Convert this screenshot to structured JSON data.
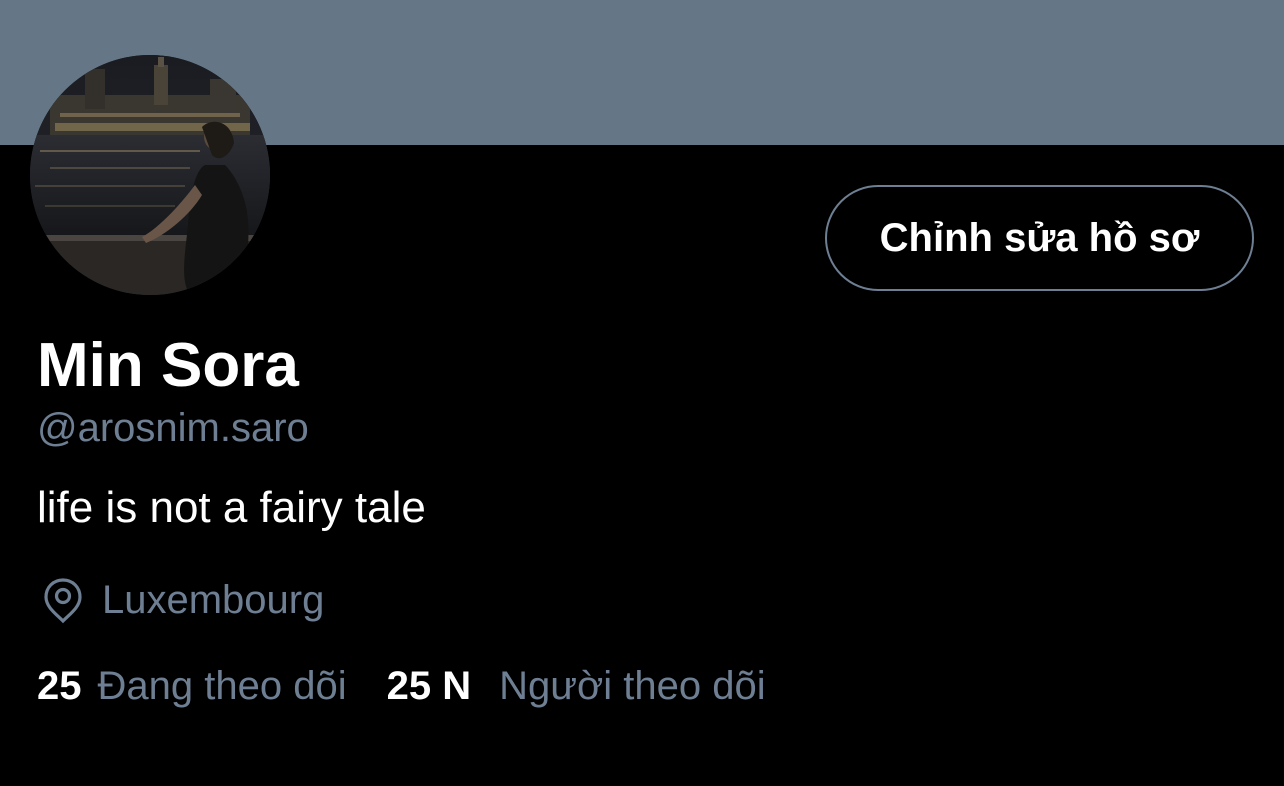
{
  "colors": {
    "banner": "#657786",
    "background": "#000000",
    "text_primary": "#ffffff",
    "text_secondary": "#6e7f93",
    "button_border": "#6e7f93"
  },
  "profile": {
    "name": "Min Sora",
    "handle": "@arosnim.saro",
    "bio": "life is not a fairy tale",
    "location": "Luxembourg",
    "location_icon": "map-pin-icon",
    "edit_button_label": "Chỉnh sửa hồ sơ"
  },
  "stats": {
    "following_count": "25",
    "following_label": "Đang theo dõi",
    "followers_count": "25 N",
    "followers_label": "Người theo dõi"
  }
}
